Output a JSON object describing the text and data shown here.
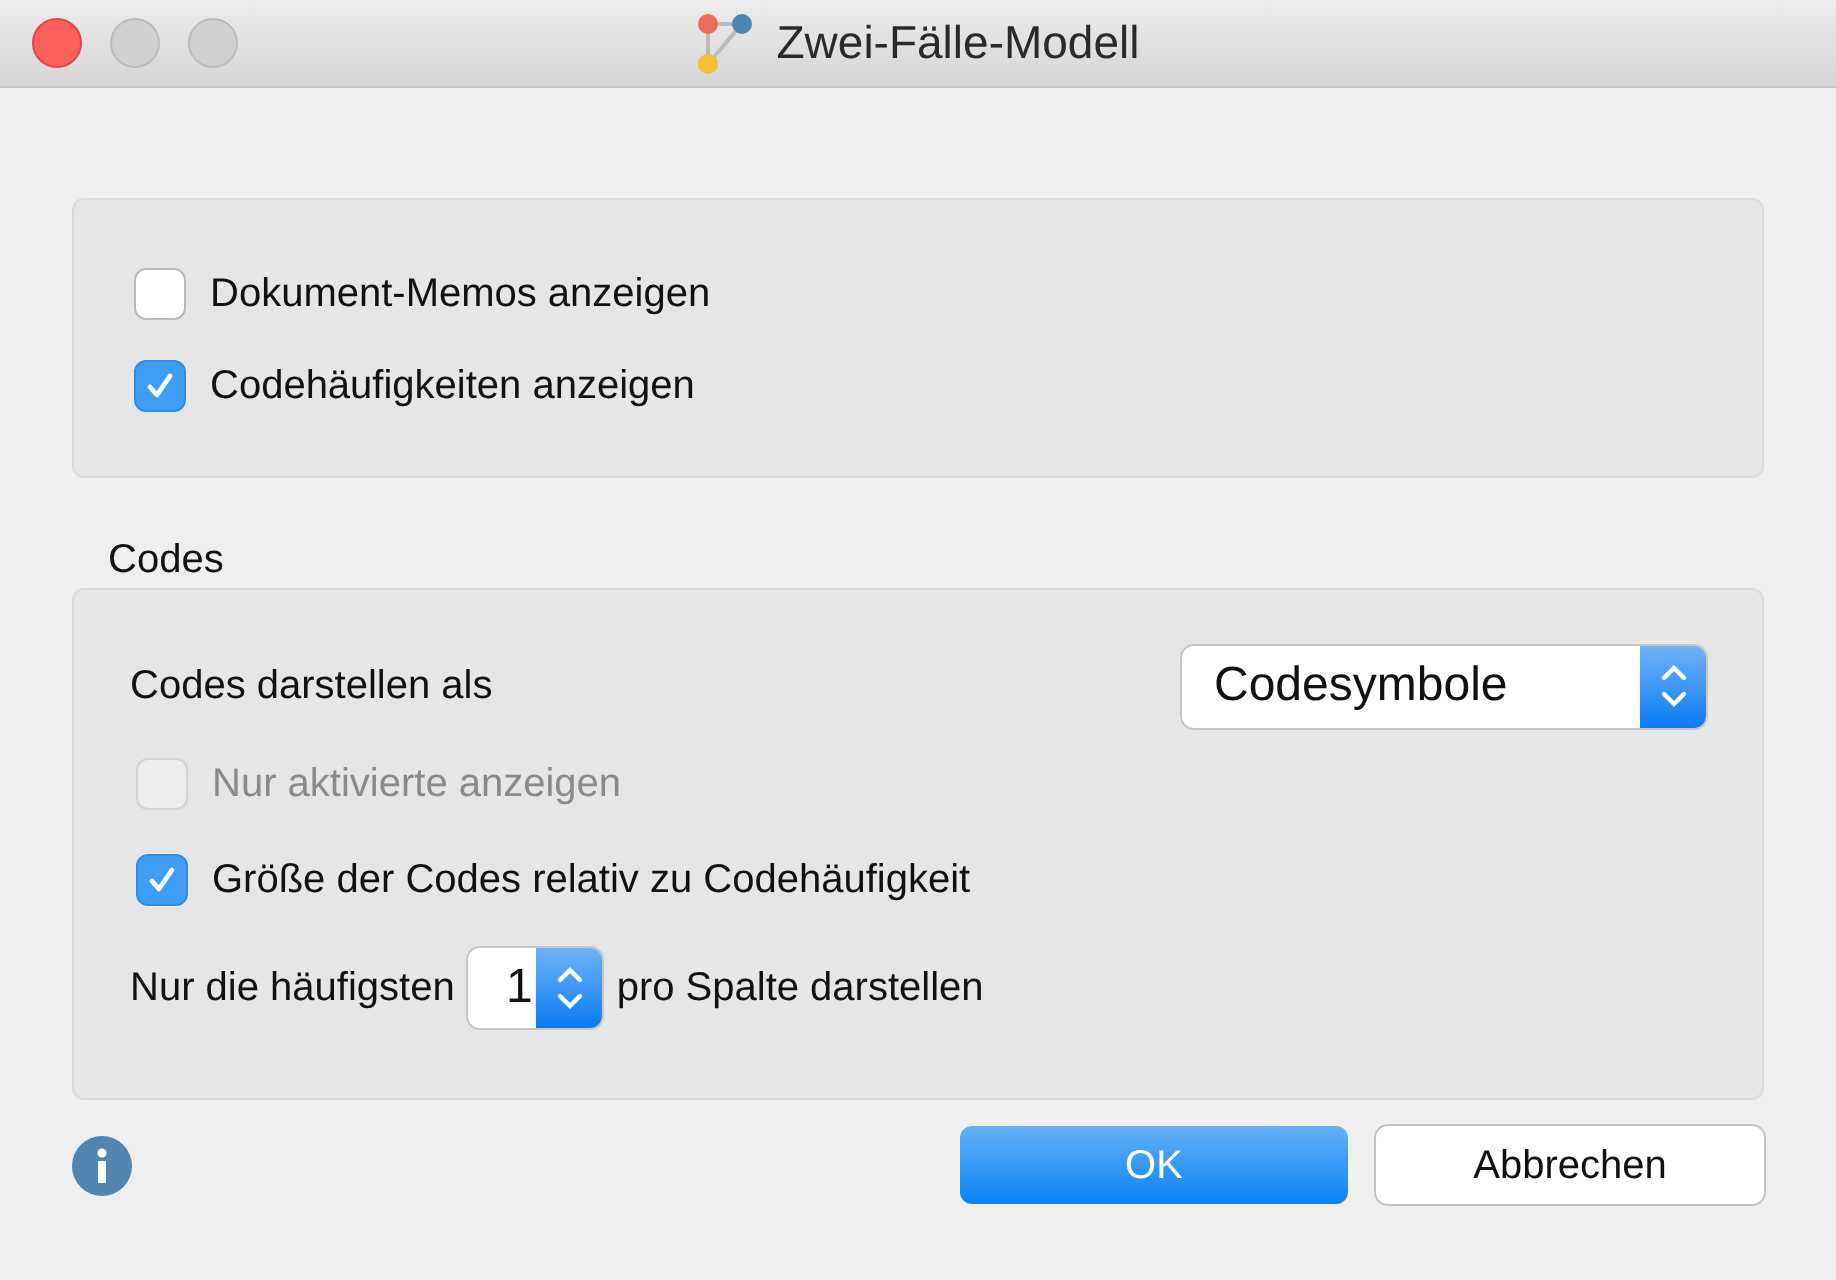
{
  "window": {
    "title": "Zwei-Fälle-Modell"
  },
  "options": [
    {
      "label": "Dokument-Memos anzeigen",
      "checked": false,
      "disabled": false
    },
    {
      "label": "Codehäufigkeiten anzeigen",
      "checked": true,
      "disabled": false
    }
  ],
  "codes": {
    "heading": "Codes",
    "display": {
      "label": "Codes darstellen als",
      "value": "Codesymbole"
    },
    "options": [
      {
        "label": "Nur aktivierte anzeigen",
        "checked": false,
        "disabled": true
      },
      {
        "label": "Größe der Codes relativ zu Codehäufigkeit",
        "checked": true,
        "disabled": false
      }
    ],
    "limit": {
      "before": "Nur die häufigsten",
      "value": "1",
      "after": "pro Spalte darstellen"
    }
  },
  "buttons": [
    {
      "label": "OK",
      "default": true
    },
    {
      "label": "Abbrechen",
      "default": false
    }
  ]
}
